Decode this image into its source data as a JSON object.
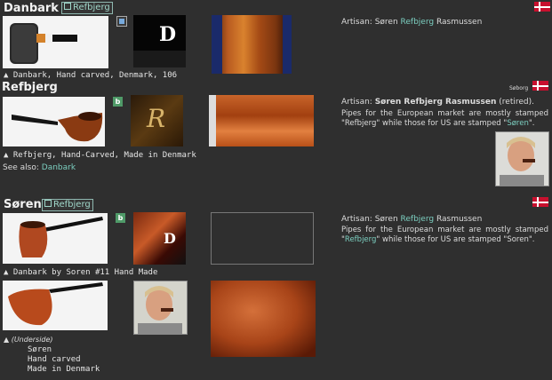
{
  "entries": [
    {
      "title": "Danbark",
      "link_label": "Refbjerg",
      "caption": "▲ Danbark, Hand carved, Denmark, 106",
      "artisan_prefix": "Artisan: Søren ",
      "artisan_highlight": "Refbjerg",
      "artisan_suffix": " Rasmussen",
      "thumb_d_letter": "D"
    },
    {
      "title": "Refbjerg",
      "location": "Søborg",
      "badge": "b",
      "caption": "▲  Refbjerg, Hand-Carved, Made in Denmark",
      "see_also_label": "See also: ",
      "see_also_link": "Danbark",
      "artisan_prefix": "Artisan: ",
      "artisan_bold": "Søren Refbjerg Rasmussen",
      "artisan_suffix": " (retired).",
      "desc_a": "Pipes for the European market are mostly stamped \"Refbjerg\" while those for US are stamped \"",
      "desc_hl": "Søren",
      "desc_b": "\".",
      "thumb_r_letter": "R"
    },
    {
      "title": "Søren",
      "link_label": "Refbjerg",
      "badge": "b",
      "caption": "▲  Danbark by Soren #11 Hand Made",
      "artisan_prefix": "Artisan: Søren ",
      "artisan_highlight": "Refbjerg",
      "artisan_suffix": " Rasmussen",
      "desc_a": "Pipes for the European market are mostly stamped \"",
      "desc_hl": "Refbjerg",
      "desc_b": "\" while those for US are stamped \"Soren\".",
      "underside_label": "▲ (Underside)",
      "stamp_lines": [
        "Søren",
        "Hand carved",
        "Made in Denmark"
      ],
      "thumb_d_letter": "D"
    }
  ],
  "colors": {
    "background": "#2f2f2f",
    "link": "#7ccfc0",
    "flag_red": "#c8102e",
    "badge_green": "#4f9a68"
  },
  "icons": [
    "denmark-flag-icon",
    "external-link-icon",
    "badge-b-icon",
    "caption-arrow-icon"
  ]
}
